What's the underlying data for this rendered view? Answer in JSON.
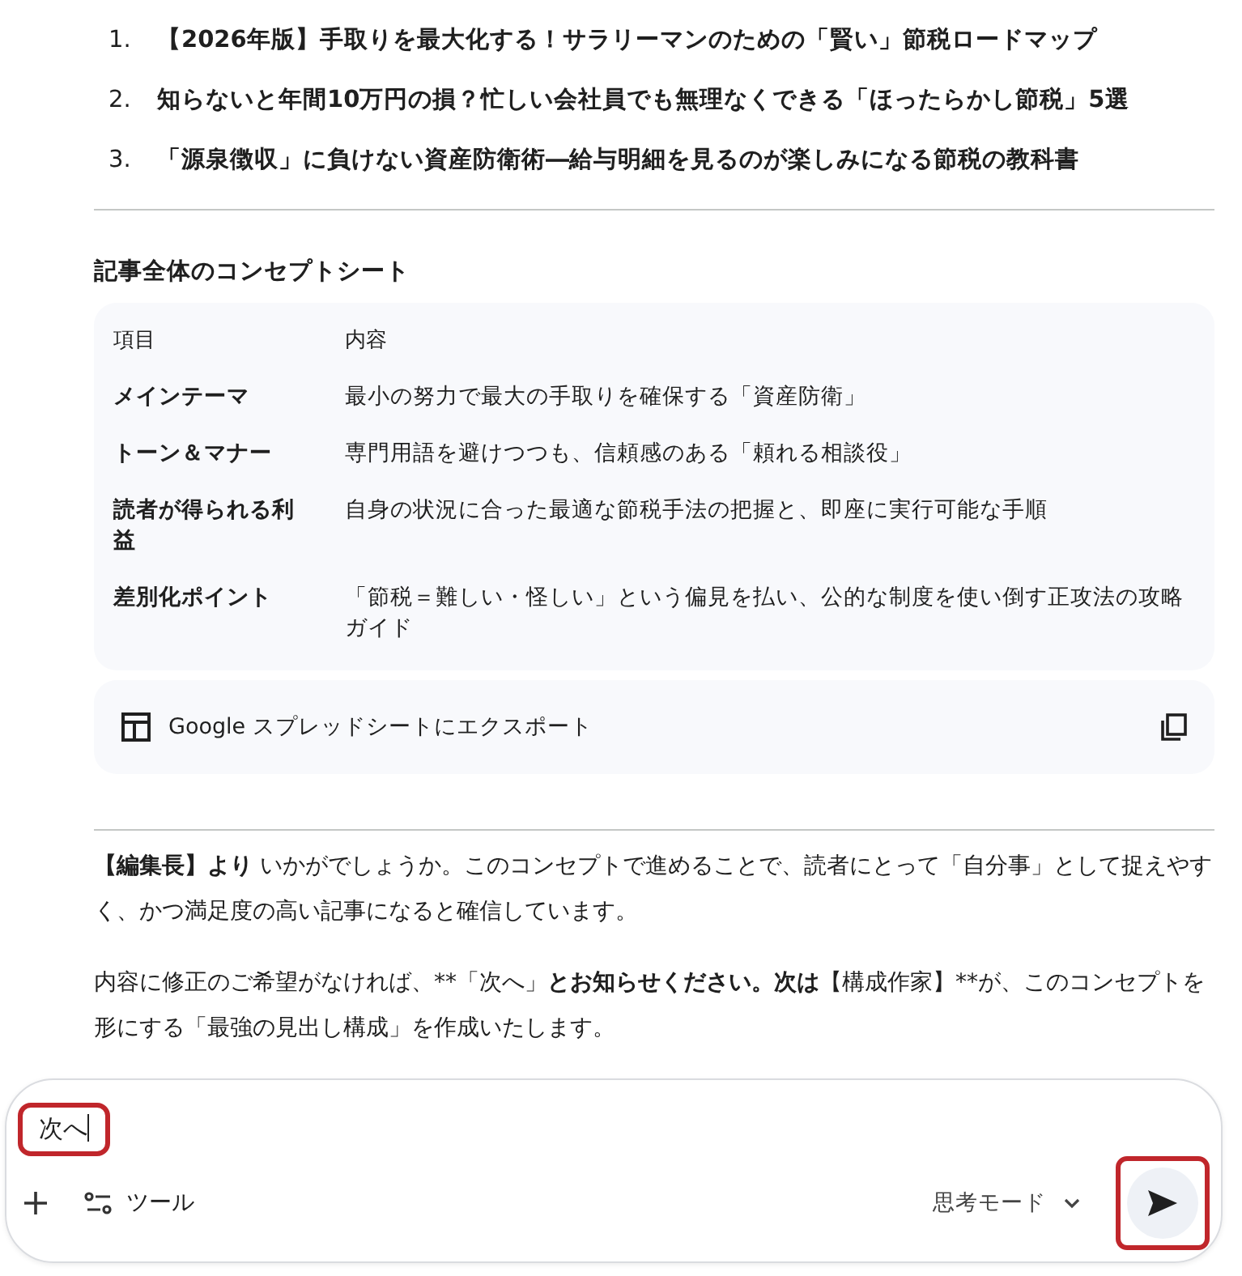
{
  "titles": [
    {
      "number": "1.",
      "text": "【2026年版】手取りを最大化する！サラリーマンのための「賢い」節税ロードマップ"
    },
    {
      "number": "2.",
      "text": "知らないと年間10万円の損？忙しい会社員でも無理なくできる「ほったらかし節税」5選"
    },
    {
      "number": "3.",
      "text": "「源泉徴収」に負けない資産防衛術―給与明細を見るのが楽しみになる節税の教科書"
    }
  ],
  "concept": {
    "heading": "記事全体のコンセプトシート",
    "table": {
      "columns": [
        "項目",
        "内容"
      ],
      "rows": [
        [
          "メインテーマ",
          "最小の努力で最大の手取りを確保する「資産防衛」"
        ],
        [
          "トーン＆マナー",
          "専門用語を避けつつも、信頼感のある「頼れる相談役」"
        ],
        [
          "読者が得られる利益",
          "自身の状況に合った最適な節税手法の把握と、即座に実行可能な手順"
        ],
        [
          "差別化ポイント",
          "「節税＝難しい・怪しい」という偏見を払い、公的な制度を使い倒す正攻法の攻略ガイド"
        ]
      ]
    },
    "export_label": "Google スプレッドシートにエクスポート"
  },
  "paragraphs": [
    [
      {
        "text": "【編集長】より",
        "bold": true
      },
      {
        "text": " いかがでしょうか。このコンセプトで進めることで、読者にとって「自分事」として捉えやすく、かつ満足度の高い記事になると確信しています。",
        "bold": false
      }
    ],
    [
      {
        "text": "内容に修正のご希望がなければ、**「次へ」",
        "bold": false
      },
      {
        "text": "とお知らせください。次は",
        "bold": true
      },
      {
        "text": "【構成作家】**が、このコンセプトを形にする「最強の見出し構成」を作成いたします。",
        "bold": false
      }
    ]
  ],
  "composer": {
    "value": "次へ",
    "value_highlighted": true,
    "tools_label": "ツール",
    "mode_label": "思考モード",
    "send_highlighted": true
  }
}
